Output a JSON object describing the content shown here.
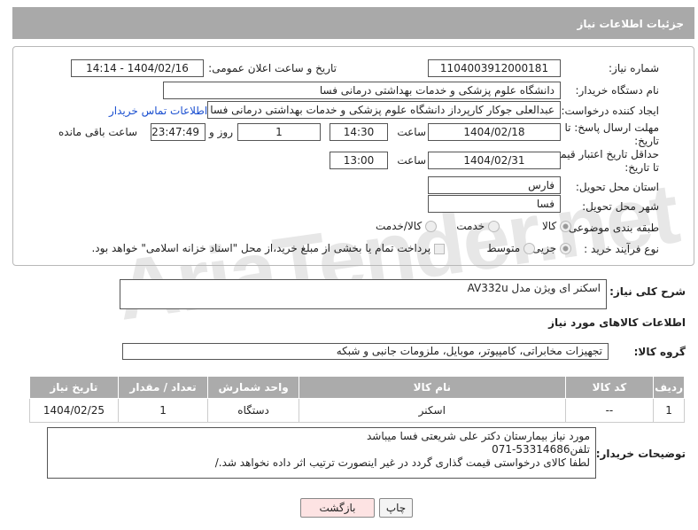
{
  "header": {
    "title": "جزئیات اطلاعات نیاز"
  },
  "form": {
    "need_number_label": "شماره نیاز:",
    "need_number": "1104003912000181",
    "announce_label": "تاریخ و ساعت اعلان عمومی:",
    "announce_value": "1404/02/16 - 14:14",
    "buyer_org_label": "نام دستگاه خریدار:",
    "buyer_org": "دانشگاه علوم پزشکی و خدمات بهداشتی درمانی فسا",
    "creator_label": "ایجاد کننده درخواست:",
    "creator": "عبدالعلی جوکار کارپرداز دانشگاه علوم پزشکی و خدمات بهداشتی درمانی فسا",
    "contact_link": "اطلاعات تماس خریدار",
    "reply_deadline_label_1": "مهلت ارسال پاسخ: تا",
    "reply_deadline_label_2": "تاریخ:",
    "reply_date": "1404/02/18",
    "time_label": "ساعت",
    "reply_time": "14:30",
    "days_value": "1",
    "days_label": "روز و",
    "remaining_value": "23:47:49",
    "remaining_label": "ساعت باقی مانده",
    "price_validity_label_1": "حداقل تاریخ اعتبار قیمت:",
    "price_validity_label_2": "تا تاریخ:",
    "price_date": "1404/02/31",
    "price_time": "13:00",
    "province_label": "استان محل تحویل:",
    "province": "فارس",
    "city_label": "شهر محل تحویل:",
    "city": "فسا",
    "category_label": "طبقه بندی موضوعی:",
    "category_options": [
      "کالا",
      "خدمت",
      "کالا/خدمت"
    ],
    "process_label": "نوع فرآیند خرید :",
    "process_options": [
      "جزیی",
      "متوسط"
    ],
    "payment_note": "پرداخت تمام یا بخشی از مبلغ خرید،از محل \"اسناد خزانه اسلامی\" خواهد بود."
  },
  "description": {
    "label": "شرح کلی نیاز:",
    "value": "اسکنر ای ویژن مدل AV332u"
  },
  "goods_section": {
    "title": "اطلاعات کالاهای مورد نیاز"
  },
  "goods_group": {
    "label": "گروه کالا:",
    "value": "تجهیزات مخابراتی، کامپیوتر، موبایل، ملزومات جانبی و شبکه"
  },
  "table": {
    "headers": [
      "ردیف",
      "کد کالا",
      "نام کالا",
      "واحد شمارش",
      "تعداد / مقدار",
      "تاریخ نیاز"
    ],
    "rows": [
      [
        "1",
        "--",
        "اسکنر",
        "دستگاه",
        "1",
        "1404/02/25"
      ]
    ]
  },
  "buyer_notes": {
    "label": "توضیحات خریدار:",
    "lines": [
      "مورد نیاز بیمارستان دکتر علی شریعتی فسا میباشد",
      "تلفن53314686-071",
      "لطفا کالای درخواستی قیمت گذاری گردد در غیر اینصورت ترتیب اثر داده نخواهد شد./"
    ]
  },
  "buttons": {
    "print": "چاپ",
    "back": "بازگشت"
  },
  "watermark": "AriaTender.net",
  "colors": {
    "header_bg": "#a9a9a9",
    "link": "#1a4fd0",
    "back_button_bg": "#fde3e3"
  }
}
